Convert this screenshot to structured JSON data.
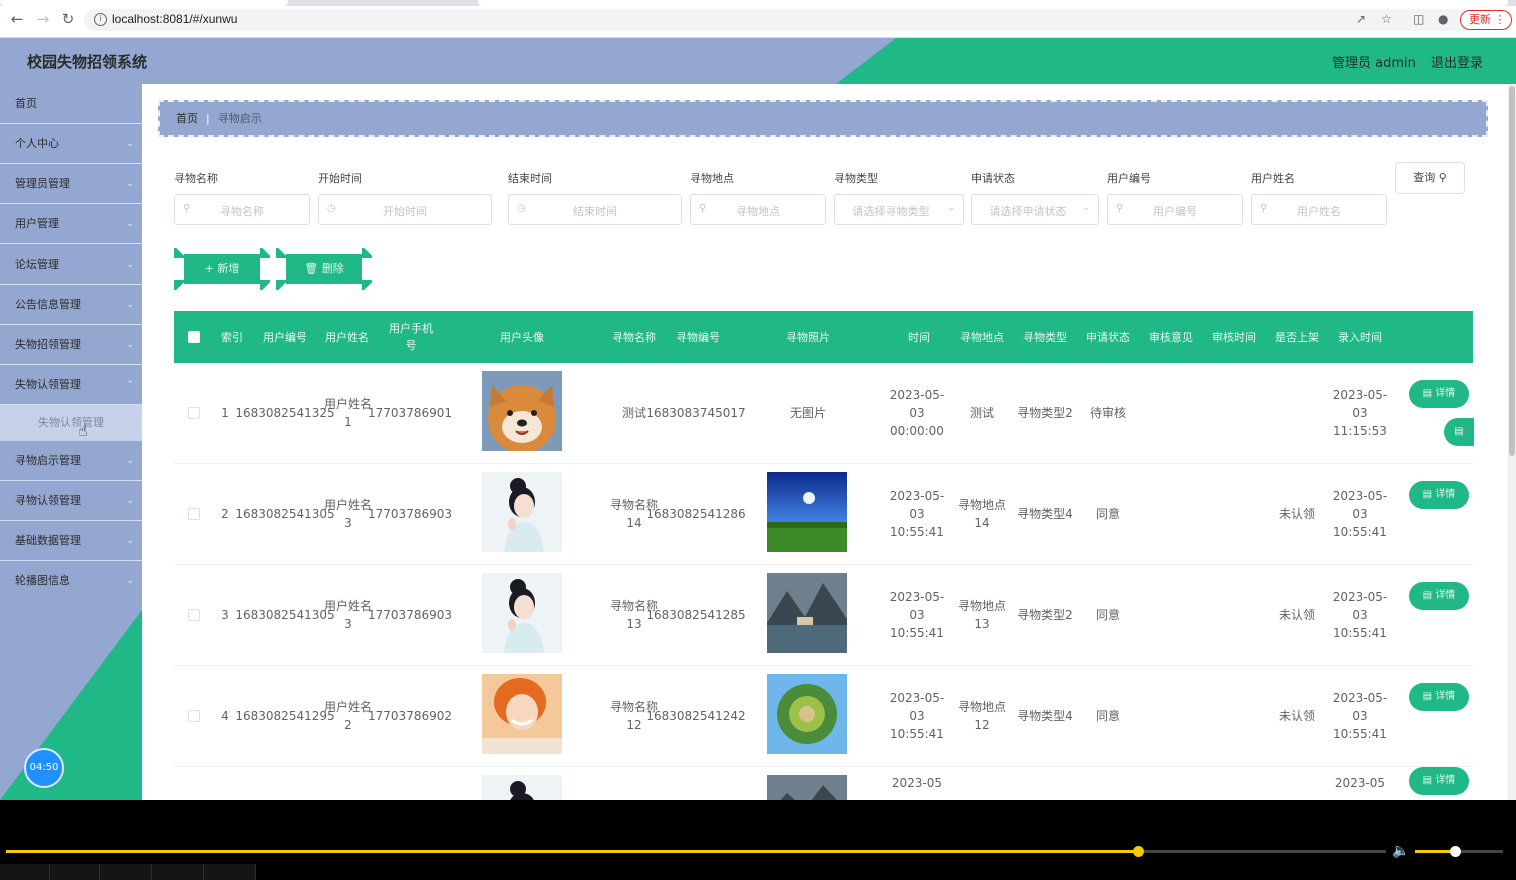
{
  "browser": {
    "url": "localhost:8081/#/xunwu",
    "update_label": "更新"
  },
  "header": {
    "title": "校园失物招领系统",
    "user": "管理员 admin",
    "logout": "退出登录"
  },
  "sidebar": {
    "items": [
      {
        "label": "首页",
        "has_children": false
      },
      {
        "label": "个人中心",
        "has_children": true
      },
      {
        "label": "管理员管理",
        "has_children": true
      },
      {
        "label": "用户管理",
        "has_children": true
      },
      {
        "label": "论坛管理",
        "has_children": true
      },
      {
        "label": "公告信息管理",
        "has_children": true
      },
      {
        "label": "失物招领管理",
        "has_children": true
      },
      {
        "label": "失物认领管理",
        "has_children": true
      },
      {
        "label": "寻物启示管理",
        "has_children": true
      },
      {
        "label": "寻物认领管理",
        "has_children": true
      },
      {
        "label": "基础数据管理",
        "has_children": true
      },
      {
        "label": "轮播图信息",
        "has_children": true
      }
    ],
    "submenu_label": "失物认领管理",
    "timer": "04:50"
  },
  "breadcrumb": {
    "home": "首页",
    "current": "寻物启示"
  },
  "filters": {
    "name": {
      "label": "寻物名称",
      "placeholder": "寻物名称"
    },
    "start": {
      "label": "开始时间",
      "placeholder": "开始时间"
    },
    "end": {
      "label": "结束时间",
      "placeholder": "结束时间"
    },
    "place": {
      "label": "寻物地点",
      "placeholder": "寻物地点"
    },
    "type": {
      "label": "寻物类型",
      "placeholder": "请选择寻物类型"
    },
    "status": {
      "label": "申请状态",
      "placeholder": "请选择申请状态"
    },
    "user_no": {
      "label": "用户编号",
      "placeholder": "用户编号"
    },
    "user_name": {
      "label": "用户姓名",
      "placeholder": "用户姓名"
    },
    "search_label": "查询"
  },
  "actions": {
    "add": "新增",
    "delete": "删除"
  },
  "table": {
    "columns": [
      "索引",
      "用户编号",
      "用户姓名",
      "用户手机号",
      "用户头像",
      "寻物名称",
      "寻物编号",
      "寻物照片",
      "时间",
      "寻物地点",
      "寻物类型",
      "申请状态",
      "审核意见",
      "审核时间",
      "是否上架",
      "录入时间"
    ],
    "detail_label": "详情",
    "rows": [
      {
        "index": "1",
        "user_no": "1683082541325",
        "user_name": "用户姓名1",
        "phone": "17703786901",
        "item_name": "测试",
        "item_no": "1683083745017",
        "photo": "无图片",
        "time": "2023-05-03 00:00:00",
        "place": "测试",
        "type": "寻物类型2",
        "status": "待审核",
        "opinion": "",
        "audit_time": "",
        "listed": "",
        "created": "2023-05-03 11:15:53"
      },
      {
        "index": "2",
        "user_no": "1683082541305",
        "user_name": "用户姓名3",
        "phone": "17703786903",
        "item_name": "寻物名称14",
        "item_no": "1683082541286",
        "photo": "",
        "time": "2023-05-03 10:55:41",
        "place": "寻物地点14",
        "type": "寻物类型4",
        "status": "同意",
        "opinion": "",
        "audit_time": "",
        "listed": "未认领",
        "created": "2023-05-03 10:55:41"
      },
      {
        "index": "3",
        "user_no": "1683082541305",
        "user_name": "用户姓名3",
        "phone": "17703786903",
        "item_name": "寻物名称13",
        "item_no": "1683082541285",
        "photo": "",
        "time": "2023-05-03 10:55:41",
        "place": "寻物地点13",
        "type": "寻物类型2",
        "status": "同意",
        "opinion": "",
        "audit_time": "",
        "listed": "未认领",
        "created": "2023-05-03 10:55:41"
      },
      {
        "index": "4",
        "user_no": "1683082541295",
        "user_name": "用户姓名2",
        "phone": "17703786902",
        "item_name": "寻物名称12",
        "item_no": "1683082541242",
        "photo": "",
        "time": "2023-05-03 10:55:41",
        "place": "寻物地点12",
        "type": "寻物类型4",
        "status": "同意",
        "opinion": "",
        "audit_time": "",
        "listed": "未认领",
        "created": "2023-05-03 10:55:41"
      }
    ],
    "partial_row": {
      "time": "2023-05",
      "created": "2023-05"
    }
  },
  "video": {
    "progress": 0.82,
    "volume": 0.45
  },
  "colors": {
    "accent_green": "#20b887",
    "header_blue": "#94a7d1"
  }
}
